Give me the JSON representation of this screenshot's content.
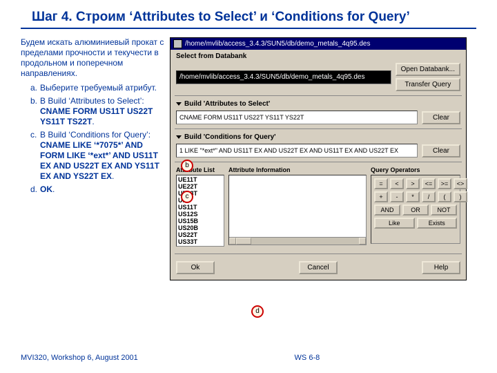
{
  "title": "Шаг 4. Строим ‘Attributes to Select’ и ‘Conditions for Query’",
  "intro": "Будем искать алюминиевый прокат с пределами прочности и текучести в продольном и поперечном направлениях.",
  "steps": {
    "a": {
      "letter": "a.",
      "text": "Выберите требуемый атрибут."
    },
    "b": {
      "letter": "b.",
      "lead": "В Build ‘Attributes to Select’:",
      "bold": "CNAME FORM US11T US22T YS11T TS22T"
    },
    "c": {
      "letter": "c.",
      "lead": "В Build ‘Conditions for Query’:",
      "bold": "CNAME LIKE ‘*7075*’ AND FORM LIKE ‘*ext*’ AND US11T EX AND US22T EX AND YS11T EX AND YS22T EX"
    },
    "d": {
      "letter": "d.",
      "bold": "OK"
    }
  },
  "footer_left": "MVI320, Workshop 6, August 2001",
  "footer_center": "WS 6-8",
  "win": {
    "title": "/home/mvlib/access_3.4.3/SUN5/db/demo_metals_4q95.des",
    "select_hdr": "Select from Databank",
    "path": "/home/mvlib/access_3.4.3/SUN5/db/demo_metals_4q95.des",
    "open_db": "Open Databank...",
    "transfer": "Transfer Query",
    "build_attrs_hdr": "Build 'Attributes to Select'",
    "attrs_val": "CNAME FORM US11T US22T YS11T YS22T",
    "clear": "Clear",
    "build_cond_hdr": "Build 'Conditions for Query'",
    "cond_val": "1 LIKE \"*ext*\" AND US11T EX AND US22T EX AND US11T EX AND US22T EX",
    "attr_list_hdr": "Attribute List",
    "attr_info_hdr": "Attribute Information",
    "ops_hdr": "Query Operators",
    "list_items": [
      "UE11T",
      "UE22T",
      "UE33T",
      "UNS",
      "US11T",
      "US12S",
      "US15B",
      "US20B",
      "US22T",
      "US33T"
    ],
    "ops_row1": [
      "=",
      "<",
      ">",
      "<=",
      ">=",
      "<>"
    ],
    "ops_row2": [
      "+",
      "-",
      "*",
      "/",
      "(",
      ")"
    ],
    "ops_row3": [
      "AND",
      "OR",
      "NOT"
    ],
    "ops_row4": [
      "Like",
      "Exists"
    ],
    "ok": "Ok",
    "cancel": "Cancel",
    "help": "Help"
  },
  "callouts": {
    "b": "b",
    "c": "c",
    "d": "d"
  }
}
